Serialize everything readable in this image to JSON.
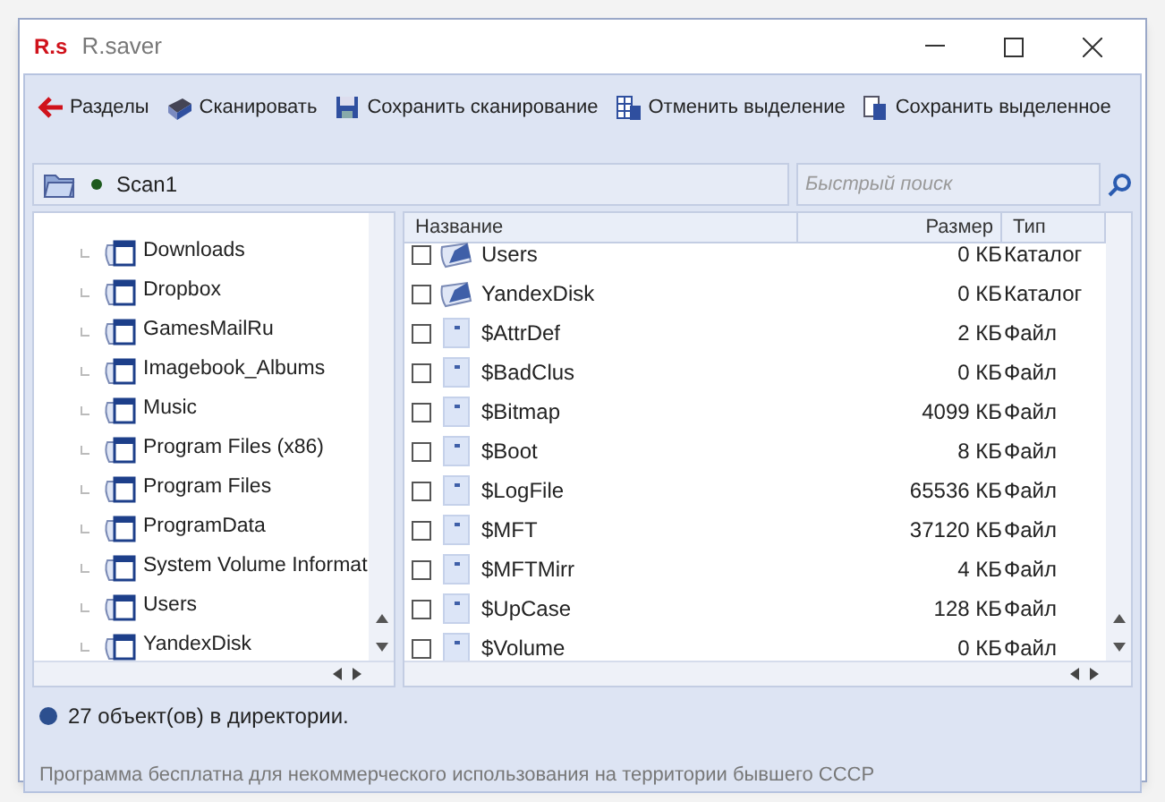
{
  "window": {
    "title": "R.saver",
    "logo": "R.s"
  },
  "toolbar": [
    {
      "kind": "back",
      "label": "Разделы"
    },
    {
      "kind": "scan",
      "label": "Сканировать"
    },
    {
      "kind": "save",
      "label": "Сохранить сканирование"
    },
    {
      "kind": "deselect",
      "label": "Отменить выделение"
    },
    {
      "kind": "export",
      "label": "Сохранить выделенное"
    }
  ],
  "address": {
    "value": "Scan1",
    "placeholder": "Быстрый поиск"
  },
  "tree": {
    "items": [
      {
        "label": "Downloads"
      },
      {
        "label": "Dropbox"
      },
      {
        "label": "GamesMailRu"
      },
      {
        "label": "Imagebook_Albums"
      },
      {
        "label": "Music"
      },
      {
        "label": "Program Files (x86)"
      },
      {
        "label": "Program Files"
      },
      {
        "label": "ProgramData"
      },
      {
        "label": "System Volume Informat"
      },
      {
        "label": "Users"
      },
      {
        "label": "YandexDisk"
      }
    ]
  },
  "table": {
    "columns": [
      "Название",
      "Размер",
      "Тип"
    ],
    "rows": [
      {
        "kind": "folder",
        "name": "Users",
        "size": "0 КБ",
        "type": "Каталог",
        "checked": false
      },
      {
        "kind": "folder",
        "name": "YandexDisk",
        "size": "0 КБ",
        "type": "Каталог",
        "checked": false
      },
      {
        "kind": "file",
        "name": "$AttrDef",
        "size": "2 КБ",
        "type": "Файл",
        "checked": false
      },
      {
        "kind": "file",
        "name": "$BadClus",
        "size": "0 КБ",
        "type": "Файл",
        "checked": false
      },
      {
        "kind": "file",
        "name": "$Bitmap",
        "size": "4099 КБ",
        "type": "Файл",
        "checked": false
      },
      {
        "kind": "file",
        "name": "$Boot",
        "size": "8 КБ",
        "type": "Файл",
        "checked": false
      },
      {
        "kind": "file",
        "name": "$LogFile",
        "size": "65536 КБ",
        "type": "Файл",
        "checked": false
      },
      {
        "kind": "file",
        "name": "$MFT",
        "size": "37120 КБ",
        "type": "Файл",
        "checked": false
      },
      {
        "kind": "file",
        "name": "$MFTMirr",
        "size": "4 КБ",
        "type": "Файл",
        "checked": false
      },
      {
        "kind": "file",
        "name": "$UpCase",
        "size": "128 КБ",
        "type": "Файл",
        "checked": false
      },
      {
        "kind": "file",
        "name": "$Volume",
        "size": "0 КБ",
        "type": "Файл",
        "checked": false
      }
    ]
  },
  "status_bar": {
    "count": "27 объект(ов) в директории.",
    "note": "Программа бесплатна для некоммерческого использования на территории бывшего СССР"
  }
}
